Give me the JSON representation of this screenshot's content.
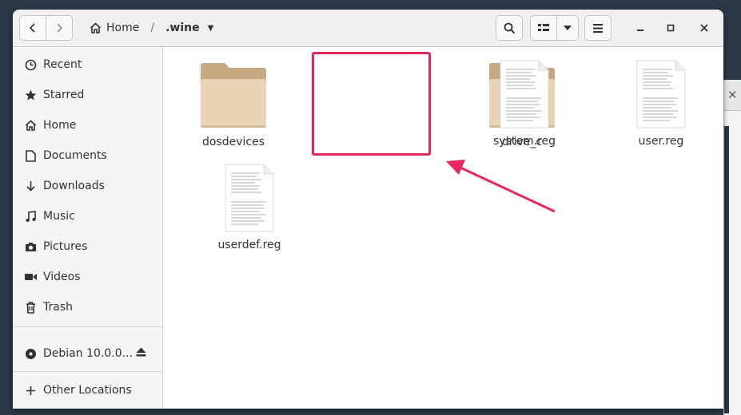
{
  "window": {
    "path": {
      "home_label": "Home",
      "separator": "/",
      "current": ".wine"
    },
    "toolbar_icons": [
      "go-back-icon",
      "go-forward-icon",
      "search-icon",
      "view-list-icon",
      "dropdown-icon",
      "hamburger-menu-icon"
    ],
    "window_controls": [
      "minimize-icon",
      "maximize-icon",
      "close-icon"
    ]
  },
  "sidebar": {
    "items": [
      {
        "label": "Recent",
        "icon": "clock-icon"
      },
      {
        "label": "Starred",
        "icon": "star-icon"
      },
      {
        "label": "Home",
        "icon": "home-icon"
      },
      {
        "label": "Documents",
        "icon": "document-icon"
      },
      {
        "label": "Downloads",
        "icon": "download-icon"
      },
      {
        "label": "Music",
        "icon": "music-icon"
      },
      {
        "label": "Pictures",
        "icon": "camera-icon"
      },
      {
        "label": "Videos",
        "icon": "video-icon"
      },
      {
        "label": "Trash",
        "icon": "trash-icon"
      }
    ],
    "devices": [
      {
        "label": "Debian 10.0.0...",
        "icon": "disc-icon",
        "action_icon": "eject-icon"
      }
    ],
    "other": [
      {
        "label": "Other Locations",
        "icon": "plus-icon"
      }
    ]
  },
  "files": [
    {
      "name": "dosdevices",
      "type": "folder"
    },
    {
      "name": "drive_c",
      "type": "folder",
      "highlighted": true
    },
    {
      "name": "system.reg",
      "type": "document"
    },
    {
      "name": "user.reg",
      "type": "document"
    },
    {
      "name": "userdef.reg",
      "type": "document"
    }
  ],
  "annotation": {
    "color": "#e8275d"
  },
  "colors": {
    "folder_body": "#e8d4b4",
    "folder_back": "#c6a983",
    "headerbar": "#f1f0ef",
    "sidebar": "#f6f5f4",
    "desktop": "#2b3847"
  }
}
